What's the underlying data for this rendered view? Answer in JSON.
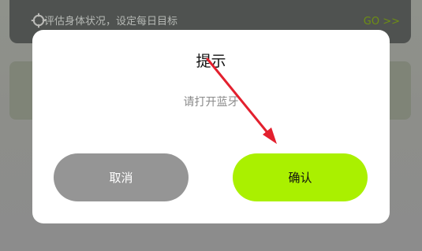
{
  "background": {
    "banner_text": "评估身体状况，设定每日目标",
    "go_label": "GO >>",
    "target_icon": "target-icon"
  },
  "dialog": {
    "title": "提示",
    "message": "请打开蓝牙",
    "cancel_label": "取消",
    "confirm_label": "确认"
  },
  "colors": {
    "confirm_button": "#aaf000",
    "cancel_button": "#959595",
    "annotation_arrow": "#e3202e"
  }
}
